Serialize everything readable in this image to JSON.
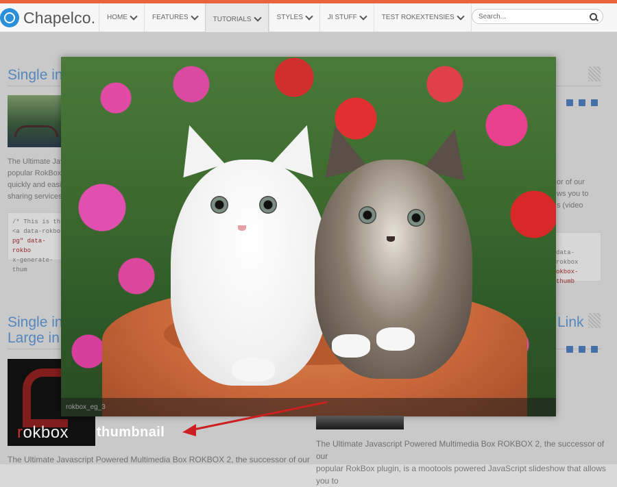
{
  "brand": {
    "name": "Chapelco."
  },
  "nav": {
    "items": [
      {
        "label": "HOME"
      },
      {
        "label": "FEATURES"
      },
      {
        "label": "TUTORIALS"
      },
      {
        "label": "STYLES"
      },
      {
        "label": "JI STUFF"
      },
      {
        "label": "TEST ROKEXTENSIES"
      }
    ],
    "active": "TUTORIALS"
  },
  "search": {
    "placeholder": "Search..."
  },
  "background": {
    "section1_title": "Single in",
    "section2_title_line1": "Single in",
    "section2_title_line2": "Large in",
    "section2_right_title": "Link",
    "para1_lines": [
      "The Ultimate Jav",
      "popular RokBox",
      "quickly and easil",
      "sharing services"
    ],
    "right_para1_lines": [
      "or of our",
      "ws you to",
      "s (video"
    ],
    "code1_lines": [
      "/* This is th",
      "<a data-rokbo",
      "pg\" data-rokbo",
      "x-generate-thum"
    ],
    "code2_lines": [
      "data-rokbox",
      "okbox-thumb"
    ],
    "bottom_left_text": "The Ultimate Javascript Powered Multimedia Box ROKBOX 2, the successor of our",
    "bottom_right_line1": "The Ultimate Javascript Powered Multimedia Box ROKBOX 2, the successor of our",
    "bottom_right_line2": "popular RokBox plugin, is a mootools powered JavaScript slideshow that allows you to",
    "rokbox_logo_text": "rokbox"
  },
  "lightbox": {
    "caption": "rokbox_eg_3"
  },
  "annotation": {
    "label": "thumbnail",
    "arrow_color": "#cc1f1f"
  }
}
